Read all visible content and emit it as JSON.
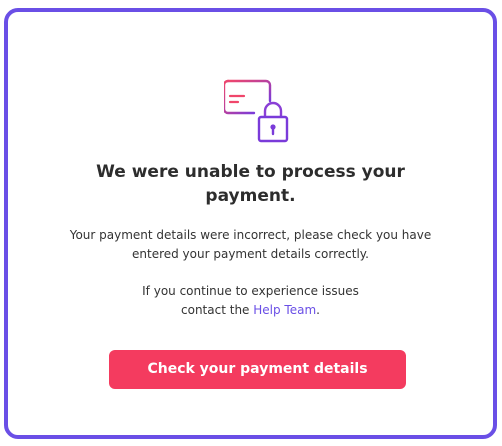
{
  "dialog": {
    "title_line1": "We were unable to process your",
    "title_line2": "payment.",
    "description_line1": "Your payment details were incorrect, please check you have",
    "description_line2": "entered your payment details correctly.",
    "contact_line1": "If you continue to experience issues",
    "contact_prefix": "contact the ",
    "help_link_label": "Help Team",
    "contact_suffix": ".",
    "cta_label": "Check your payment details",
    "icon": "credit-card-lock-icon"
  },
  "colors": {
    "border": "#6a4fe6",
    "link": "#6a4fe6",
    "cta_background": "#f43b5f",
    "icon_gradient_start": "#f0466b",
    "icon_gradient_end": "#7a3bd9"
  }
}
